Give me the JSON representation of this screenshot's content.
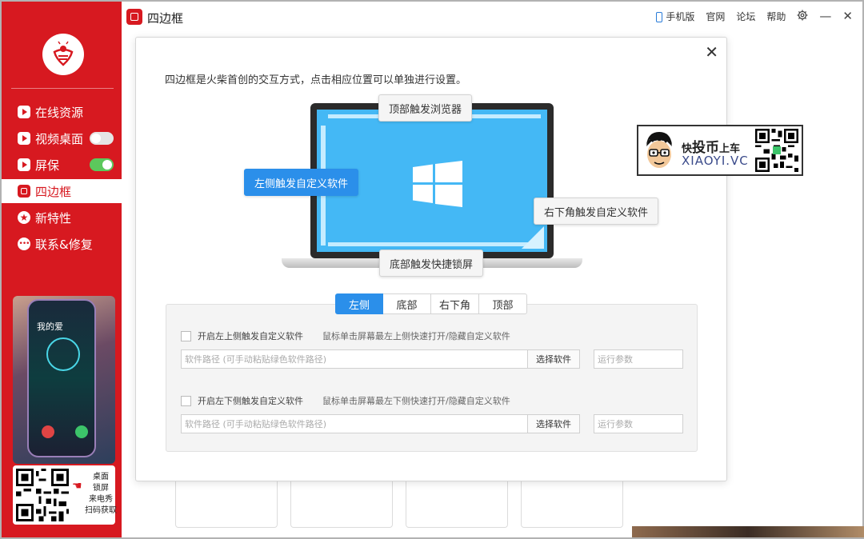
{
  "window": {
    "title": "四边框",
    "topbar": {
      "mobile": "手机版",
      "website": "官网",
      "forum": "论坛",
      "help": "帮助"
    }
  },
  "sidebar": {
    "items": [
      {
        "label": "在线资源",
        "icon": "play-icon"
      },
      {
        "label": "视频桌面",
        "icon": "play-icon",
        "toggle": "off"
      },
      {
        "label": "屏保",
        "icon": "play-icon",
        "toggle": "on"
      },
      {
        "label": "四边框",
        "icon": "frame-icon",
        "active": true
      },
      {
        "label": "新特性",
        "icon": "star-icon"
      },
      {
        "label": "联系&修复",
        "icon": "chat-icon"
      }
    ],
    "promo": {
      "phone_text": "我的爱",
      "qr_caption_lines": [
        "桌面",
        "锁屏",
        "来电秀",
        "扫码获取"
      ]
    }
  },
  "dialog": {
    "description": "四边框是火柴首创的交互方式，点击相应位置可以单独进行设置。",
    "hotspots": {
      "top": "顶部触发浏览器",
      "left": "左侧触发自定义软件",
      "bottom_right": "右下角触发自定义软件",
      "bottom": "底部触发快捷锁屏"
    },
    "tabs": [
      "左侧",
      "底部",
      "右下角",
      "顶部"
    ],
    "active_tab": "左侧",
    "options": [
      {
        "label": "开启左上侧触发自定义软件",
        "hint": "鼠标单击屏幕最左上侧快速打开/隐藏自定义软件",
        "path_placeholder": "软件路径 (可手动粘贴绿色软件路径)",
        "choose_label": "选择软件",
        "params_placeholder": "运行参数"
      },
      {
        "label": "开启左下侧触发自定义软件",
        "hint": "鼠标单击屏幕最左下侧快速打开/隐藏自定义软件",
        "path_placeholder": "软件路径 (可手动粘贴绿色软件路径)",
        "choose_label": "选择软件",
        "params_placeholder": "运行参数"
      }
    ]
  },
  "watermark": {
    "prefix": "快",
    "highlight": "投币",
    "suffix": "上车",
    "site": "XIAOYI.VC"
  },
  "colors": {
    "brand_red": "#d71920",
    "accent_blue": "#2b8fea",
    "screen_blue": "#44b8f5",
    "toggle_on": "#5cc85c"
  }
}
